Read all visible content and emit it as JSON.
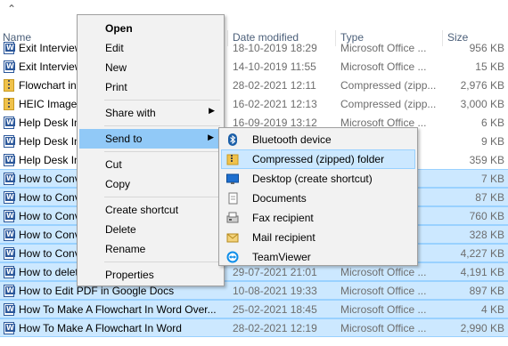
{
  "header": {
    "name": "Name",
    "date_modified": "Date modified",
    "type": "Type",
    "size": "Size"
  },
  "files": [
    {
      "name": "Exit Interview Questions",
      "date": "18-10-2019 18:29",
      "type": "Microsoft Office ...",
      "size": "956 KB",
      "icon": "word-doc-icon",
      "selected": false
    },
    {
      "name": "Exit Interview Form",
      "date": "14-10-2019 11:55",
      "type": "Microsoft Office ...",
      "size": "15 KB",
      "icon": "word-doc-icon",
      "selected": false
    },
    {
      "name": "Flowchart in Word",
      "date": "28-02-2021 12:11",
      "type": "Compressed (zipp...",
      "size": "2,976 KB",
      "icon": "zip-folder-icon",
      "selected": false
    },
    {
      "name": "HEIC Images",
      "date": "16-02-2021 12:13",
      "type": "Compressed (zipp...",
      "size": "3,000 KB",
      "icon": "zip-folder-icon",
      "selected": false
    },
    {
      "name": "Help Desk Interview",
      "date": "16-09-2019 13:12",
      "type": "Microsoft Office ...",
      "size": "6 KB",
      "icon": "word-doc-icon",
      "selected": false
    },
    {
      "name": "Help Desk Interview 2",
      "date": "",
      "type": "",
      "size": "9 KB",
      "icon": "word-doc-icon",
      "selected": false
    },
    {
      "name": "Help Desk Interview 3",
      "date": "",
      "type": "",
      "size": "359 KB",
      "icon": "word-doc-icon",
      "selected": false
    },
    {
      "name": "How to Convert PDF",
      "date": "",
      "type": "",
      "size": "7 KB",
      "icon": "word-doc-icon",
      "selected": true
    },
    {
      "name": "How to Convert Word",
      "date": "",
      "type": "",
      "size": "87 KB",
      "icon": "word-doc-icon",
      "selected": true
    },
    {
      "name": "How to Convert Excel",
      "date": "",
      "type": "",
      "size": "760 KB",
      "icon": "word-doc-icon",
      "selected": true
    },
    {
      "name": "How to Convert Images",
      "date": "",
      "type": "",
      "size": "328 KB",
      "icon": "word-doc-icon",
      "selected": true
    },
    {
      "name": "How to Convert Files",
      "date": "",
      "type": "",
      "size": "4,227 KB",
      "icon": "word-doc-icon",
      "selected": true
    },
    {
      "name": "How to delete a page",
      "date": "29-07-2021 21:01",
      "type": "Microsoft Office ...",
      "size": "4,191 KB",
      "icon": "word-doc-icon",
      "selected": true
    },
    {
      "name": "How to Edit PDF in Google Docs",
      "date": "10-08-2021 19:33",
      "type": "Microsoft Office ...",
      "size": "897 KB",
      "icon": "word-doc-icon",
      "selected": true
    },
    {
      "name": "How To Make A Flowchart In Word Over...",
      "date": "25-02-2021 18:45",
      "type": "Microsoft Office ...",
      "size": "4 KB",
      "icon": "word-doc-icon",
      "selected": true
    },
    {
      "name": "How To Make A Flowchart In Word",
      "date": "28-02-2021 12:19",
      "type": "Microsoft Office ...",
      "size": "2,990 KB",
      "icon": "word-doc-icon",
      "selected": true
    }
  ],
  "context_menu": {
    "items": [
      {
        "label": "Open",
        "bold": true
      },
      {
        "label": "Edit"
      },
      {
        "label": "New"
      },
      {
        "label": "Print"
      },
      {
        "label": "Share with",
        "has_submenu": true
      },
      {
        "label": "Send to",
        "has_submenu": true,
        "active": true
      },
      {
        "label": "Cut"
      },
      {
        "label": "Copy"
      },
      {
        "label": "Create shortcut"
      },
      {
        "label": "Delete"
      },
      {
        "label": "Rename"
      },
      {
        "label": "Properties"
      }
    ]
  },
  "send_to_menu": {
    "items": [
      {
        "label": "Bluetooth device",
        "icon": "bluetooth-icon"
      },
      {
        "label": "Compressed (zipped) folder",
        "icon": "zip-folder-icon",
        "active": true
      },
      {
        "label": "Desktop (create shortcut)",
        "icon": "desktop-icon"
      },
      {
        "label": "Documents",
        "icon": "documents-icon"
      },
      {
        "label": "Fax recipient",
        "icon": "fax-icon"
      },
      {
        "label": "Mail recipient",
        "icon": "mail-icon"
      },
      {
        "label": "TeamViewer",
        "icon": "teamviewer-icon"
      }
    ]
  },
  "colors": {
    "selection": "#cce8ff",
    "menu_highlight": "#91c9f7",
    "header_text": "#4c607a"
  }
}
